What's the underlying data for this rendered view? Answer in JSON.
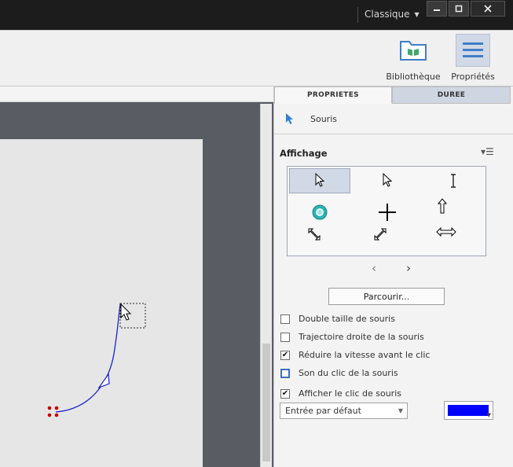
{
  "titlebar": {
    "workspace": "Classique"
  },
  "toolbar": {
    "library_label": "Bibliothèque",
    "properties_label": "Propriétés"
  },
  "panel": {
    "tabs": [
      "PROPRIETES",
      "DUREE"
    ],
    "object_name": "Souris",
    "section_title": "Affichage",
    "browse_label": "Parcourir...",
    "checkboxes": [
      {
        "label": "Double taille de souris",
        "checked": false
      },
      {
        "label": "Trajectoire droite de la souris",
        "checked": false
      },
      {
        "label": "Réduire la vitesse avant le clic",
        "checked": true
      },
      {
        "label": "Son du clic de la souris",
        "checked": false
      },
      {
        "label": "Afficher le clic de souris",
        "checked": true
      }
    ],
    "click_effect": "Entrée par défaut",
    "click_color": "#0000ff"
  },
  "colors": {
    "accent": "#2f7fd8",
    "path": "#1a22c8"
  }
}
